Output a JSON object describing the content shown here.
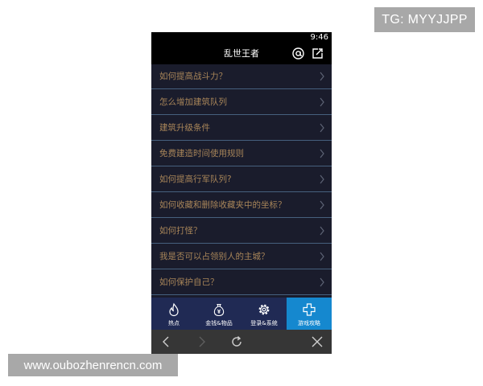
{
  "watermark_top": "TG: MYYJJPP",
  "watermark_bottom": "www.oubozhenrencn.com",
  "status_bar": {
    "time": "9:46"
  },
  "header": {
    "title": "乱世王者",
    "icons": [
      "at-icon",
      "share-icon"
    ]
  },
  "faq": {
    "items": [
      {
        "label": "如何提高战斗力？"
      },
      {
        "label": "怎么增加建筑队列"
      },
      {
        "label": "建筑升级条件"
      },
      {
        "label": "免费建造时间使用规则"
      },
      {
        "label": "如何提高行军队列?"
      },
      {
        "label": "如何收藏和删除收藏夹中的坐标？"
      },
      {
        "label": "如何打怪？"
      },
      {
        "label": "我是否可以占领别人的主城？"
      },
      {
        "label": "如何保护自己？"
      }
    ]
  },
  "tabs": [
    {
      "label": "热点",
      "icon": "flame-icon",
      "active": false
    },
    {
      "label": "金钱&物品",
      "icon": "money-bag-icon",
      "active": false
    },
    {
      "label": "登录&系统",
      "icon": "gear-icon",
      "active": false
    },
    {
      "label": "游戏攻略",
      "icon": "cross-icon",
      "active": true
    }
  ],
  "browser_bar": {
    "icons": [
      "back-icon",
      "forward-icon",
      "refresh-icon",
      "close-icon"
    ]
  },
  "colors": {
    "list_background": "#1a1c2c",
    "item_text": "#a88559",
    "divider": "#46607e",
    "tab_bar": "#202a54",
    "tab_active": "#1588cf",
    "browser_bar": "#363636"
  }
}
